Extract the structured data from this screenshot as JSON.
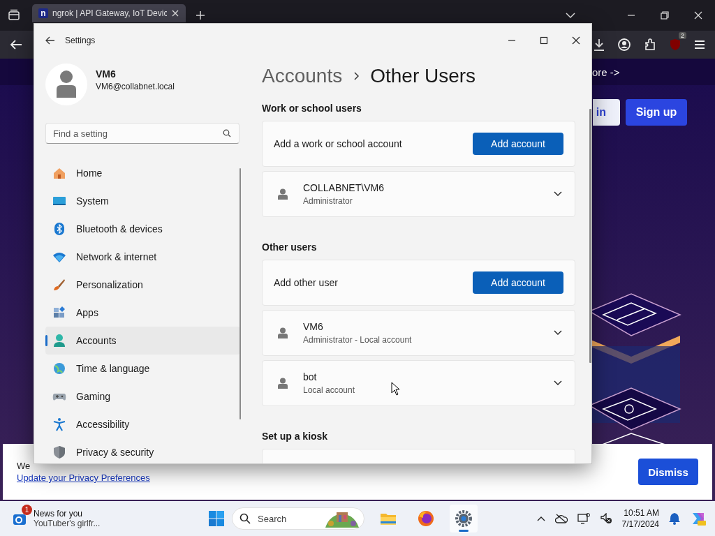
{
  "browser": {
    "tab": {
      "favicon": "n",
      "title": "ngrok | API Gateway, IoT Devic"
    },
    "extension_badge": "2",
    "page": {
      "top_link": "ore ->",
      "login": "in",
      "signup": "Sign up",
      "cookie": {
        "lead": "We",
        "link": "Update your Privacy Preferences",
        "dismiss": "Dismiss"
      }
    }
  },
  "settings": {
    "title": "Settings",
    "user": {
      "name": "VM6",
      "email": "VM6@collabnet.local"
    },
    "search": {
      "placeholder": "Find a setting"
    },
    "nav": [
      {
        "label": "Home",
        "kind": "home",
        "selected": false
      },
      {
        "label": "System",
        "kind": "system",
        "selected": false
      },
      {
        "label": "Bluetooth & devices",
        "kind": "bluetooth",
        "selected": false
      },
      {
        "label": "Network & internet",
        "kind": "network",
        "selected": false
      },
      {
        "label": "Personalization",
        "kind": "brush",
        "selected": false
      },
      {
        "label": "Apps",
        "kind": "apps",
        "selected": false
      },
      {
        "label": "Accounts",
        "kind": "accounts",
        "selected": true
      },
      {
        "label": "Time & language",
        "kind": "globe",
        "selected": false
      },
      {
        "label": "Gaming",
        "kind": "gaming",
        "selected": false
      },
      {
        "label": "Accessibility",
        "kind": "accessibility",
        "selected": false
      },
      {
        "label": "Privacy & security",
        "kind": "shield",
        "selected": false
      }
    ],
    "breadcrumb": {
      "parent": "Accounts",
      "current": "Other Users"
    },
    "sections": [
      {
        "heading": "Work or school users",
        "rows": [
          {
            "kind": "action",
            "label": "Add a work or school account",
            "button": "Add account"
          },
          {
            "kind": "user",
            "name": "COLLABNET\\VM6",
            "detail": "Administrator",
            "expanded": false
          }
        ]
      },
      {
        "heading": "Other users",
        "rows": [
          {
            "kind": "action",
            "label": "Add other user",
            "button": "Add account"
          },
          {
            "kind": "user",
            "name": "VM6",
            "detail": "Administrator - Local account",
            "expanded": false
          },
          {
            "kind": "user",
            "name": "bot",
            "detail": "Local account",
            "expanded": false
          }
        ]
      },
      {
        "heading": "Set up a kiosk",
        "rows": [
          {
            "kind": "hidden"
          }
        ]
      }
    ]
  },
  "taskbar": {
    "news": {
      "badge": "1",
      "title": "News for you",
      "subtitle": "YouTuber's girlfr..."
    },
    "search": {
      "placeholder": "Search"
    },
    "apps": [
      {
        "kind": "explorer",
        "active": false
      },
      {
        "kind": "firefox",
        "active": false
      },
      {
        "kind": "settings",
        "active": true
      }
    ],
    "clock": {
      "time": "10:51 AM",
      "date": "7/17/2024"
    }
  }
}
